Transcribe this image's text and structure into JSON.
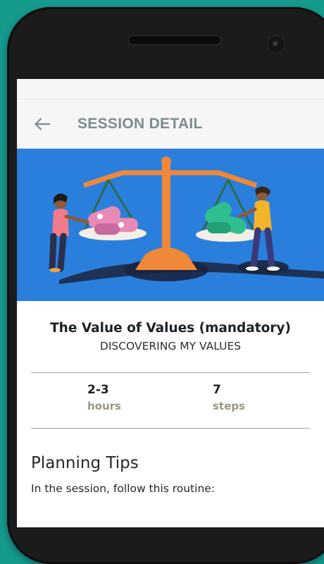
{
  "app_bar": {
    "title": "SESSION DETAIL",
    "back_icon": "arrow-left-icon"
  },
  "hero": {
    "illustration": "balance-scale-with-two-people",
    "background_color": "#2a7fdc"
  },
  "session": {
    "title": "The Value of Values (mandatory)",
    "subtitle": "DISCOVERING MY VALUES"
  },
  "stats": [
    {
      "value": "2-3",
      "unit": "hours"
    },
    {
      "value": "7",
      "unit": "steps"
    }
  ],
  "planning": {
    "heading": "Planning Tips",
    "body": "In the session, follow this routine:"
  },
  "colors": {
    "background": "#159a8c",
    "title_gray": "#7d8b94",
    "unit_tan": "#9c9582"
  }
}
